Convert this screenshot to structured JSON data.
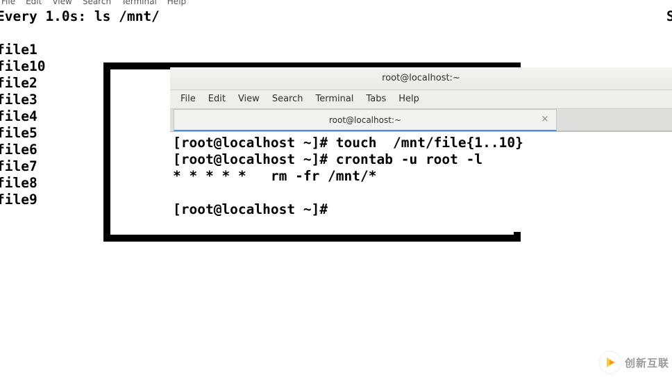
{
  "bg_window": {
    "menu": [
      "File",
      "Edit",
      "View",
      "Search",
      "Terminal",
      "Help"
    ],
    "watch_line": "Every 1.0s: ls /mnt/",
    "right_crop": "S",
    "files": [
      "file1",
      "file10",
      "file2",
      "file3",
      "file4",
      "file5",
      "file6",
      "file7",
      "file8",
      "file9"
    ]
  },
  "fg_window": {
    "title": "root@localhost:~",
    "menu": [
      "File",
      "Edit",
      "View",
      "Search",
      "Terminal",
      "Tabs",
      "Help"
    ],
    "tab_label": "root@localhost:~",
    "tab_close": "×",
    "lines": [
      "[root@localhost ~]# touch  /mnt/file{1..10}",
      "[root@localhost ~]# crontab -u root -l",
      "* * * * *   rm -fr /mnt/*",
      "",
      "[root@localhost ~]# "
    ]
  },
  "watermark": "创新互联"
}
